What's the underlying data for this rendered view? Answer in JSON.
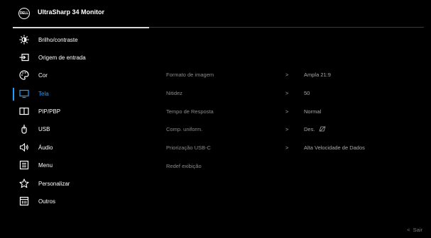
{
  "header": {
    "logo_text": "DELL",
    "title": "UltraSharp 34 Monitor"
  },
  "menu": [
    {
      "label": "Brilho/contraste",
      "icon": "brightness-icon"
    },
    {
      "label": "Origem de entrada",
      "icon": "input-source-icon"
    },
    {
      "label": "Cor",
      "icon": "color-palette-icon"
    },
    {
      "label": "Tela",
      "icon": "display-icon",
      "active": true
    },
    {
      "label": "PIP/PBP",
      "icon": "pip-pbp-icon"
    },
    {
      "label": "USB",
      "icon": "usb-icon"
    },
    {
      "label": "Áudio",
      "icon": "speaker-icon"
    },
    {
      "label": "Menu",
      "icon": "menu-icon"
    },
    {
      "label": "Personalizar",
      "icon": "star-icon"
    },
    {
      "label": "Outros",
      "icon": "others-icon"
    }
  ],
  "settings": [
    {
      "label": "Formato de imagem",
      "value": "Ampla 21:9",
      "chevron": ">"
    },
    {
      "label": "Nitidez",
      "value": "50",
      "chevron": ">"
    },
    {
      "label": "Tempo de Resposta",
      "value": "Normal",
      "chevron": ">"
    },
    {
      "label": "Comp. uniform.",
      "value": "Des.",
      "chevron": ">"
    },
    {
      "label": "Priorização USB-C",
      "value": "Alta Velocidade de Dados",
      "chevron": ">"
    },
    {
      "label": "Redef exibição",
      "value": "",
      "chevron": ""
    }
  ],
  "footer": {
    "exit_label": "Sair",
    "exit_chevron": "<"
  },
  "colors": {
    "accent": "#1e9fff",
    "background": "#000000"
  }
}
